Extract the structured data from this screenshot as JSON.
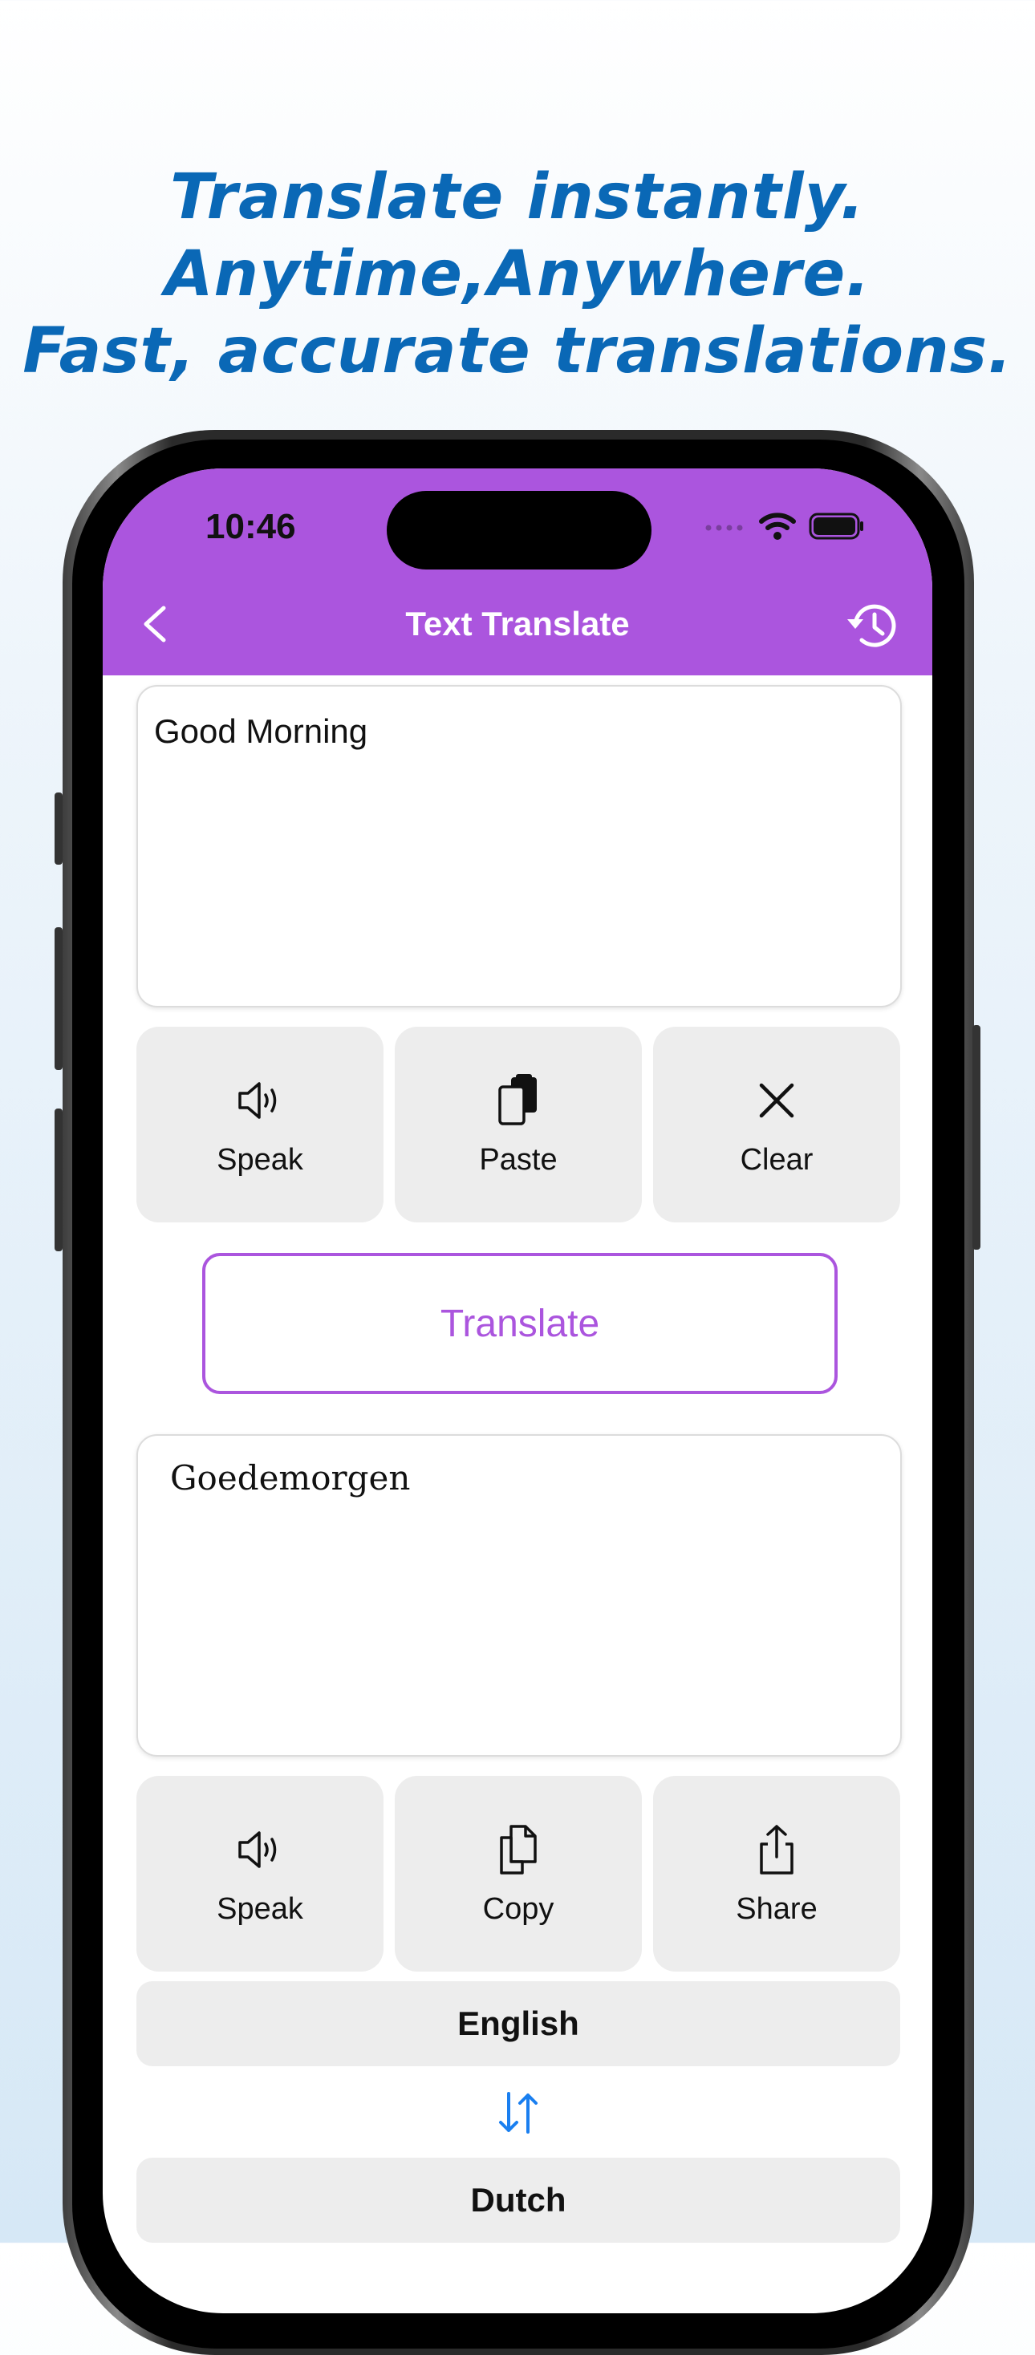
{
  "headline": {
    "line1": "Translate instantly.",
    "line2": "Anytime,Anywhere.",
    "line3": "Fast, accurate translations."
  },
  "status_bar": {
    "time": "10:46"
  },
  "nav": {
    "title": "Text Translate",
    "back_icon": "chevron-left-icon",
    "history_icon": "history-icon"
  },
  "source": {
    "text": "Good Morning"
  },
  "source_actions": [
    {
      "label": "Speak",
      "icon": "speaker-icon"
    },
    {
      "label": "Paste",
      "icon": "paste-icon"
    },
    {
      "label": "Clear",
      "icon": "close-icon"
    }
  ],
  "translate_button": {
    "label": "Translate"
  },
  "result": {
    "text": "Goedemorgen"
  },
  "result_actions": [
    {
      "label": "Speak",
      "icon": "speaker-icon"
    },
    {
      "label": "Copy",
      "icon": "copy-icon"
    },
    {
      "label": "Share",
      "icon": "share-icon"
    }
  ],
  "languages": {
    "from": "English",
    "to": "Dutch",
    "swap_icon": "swap-arrows-icon"
  },
  "colors": {
    "accent": "#ab55de",
    "headline": "#0a68b6",
    "swap": "#1a7ff0"
  }
}
